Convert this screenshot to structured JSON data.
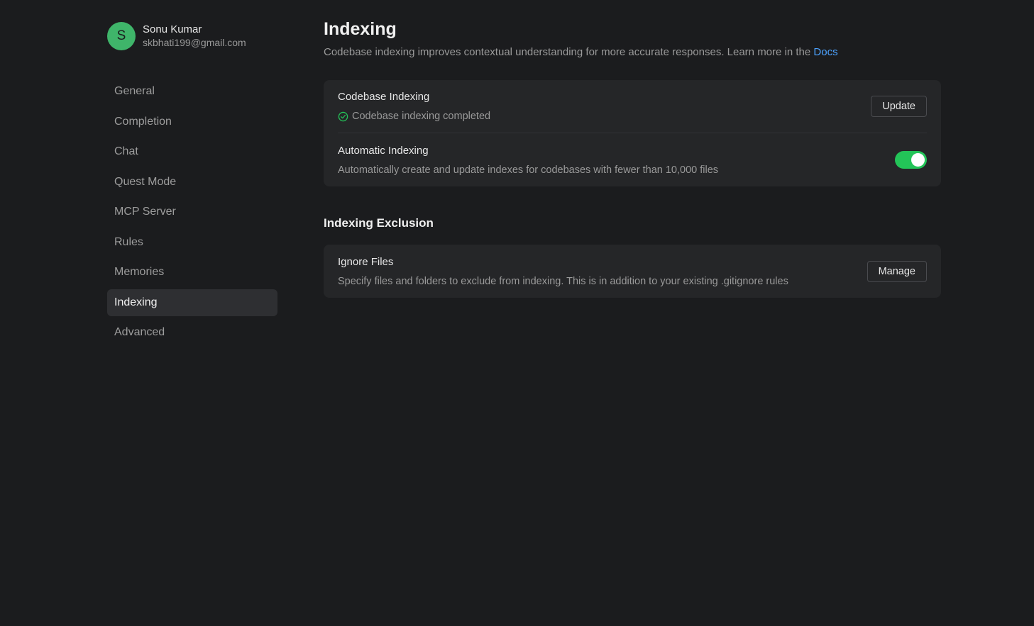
{
  "user": {
    "initial": "S",
    "name": "Sonu Kumar",
    "email": "skbhati199@gmail.com"
  },
  "sidebar": {
    "items": [
      {
        "label": "General",
        "active": false
      },
      {
        "label": "Completion",
        "active": false
      },
      {
        "label": "Chat",
        "active": false
      },
      {
        "label": "Quest Mode",
        "active": false
      },
      {
        "label": "MCP Server",
        "active": false
      },
      {
        "label": "Rules",
        "active": false
      },
      {
        "label": "Memories",
        "active": false
      },
      {
        "label": "Indexing",
        "active": true
      },
      {
        "label": "Advanced",
        "active": false
      }
    ]
  },
  "main": {
    "title": "Indexing",
    "subtitle": "Codebase indexing improves contextual understanding for more accurate responses. Learn more in the ",
    "docs_link": "Docs",
    "codebase_indexing": {
      "title": "Codebase Indexing",
      "status_icon": "check-circle-icon",
      "status": "Codebase indexing completed",
      "button": "Update"
    },
    "automatic_indexing": {
      "title": "Automatic Indexing",
      "description": "Automatically create and update indexes for codebases with fewer than 10,000 files",
      "enabled": true
    },
    "exclusion": {
      "section_title": "Indexing Exclusion",
      "title": "Ignore Files",
      "description": "Specify files and folders to exclude from indexing. This is in addition to your existing .gitignore rules",
      "button": "Manage"
    }
  },
  "colors": {
    "background": "#1b1c1e",
    "card": "#252628",
    "accent_green": "#23c458",
    "avatar": "#3fb56a",
    "link": "#4da3ff"
  }
}
